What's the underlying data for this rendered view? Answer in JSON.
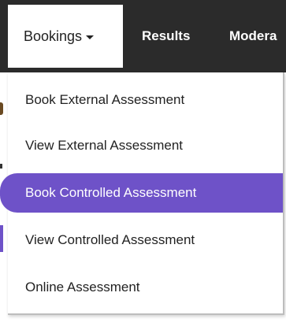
{
  "navbar": {
    "bookings_label": "Bookings",
    "results_label": "Results",
    "moderation_label": "Modera"
  },
  "dropdown": {
    "items": [
      {
        "label": "Book External Assessment",
        "active": false
      },
      {
        "label": "View External Assessment",
        "active": false
      },
      {
        "label": "Book Controlled Assessment",
        "active": true
      },
      {
        "label": "View Controlled Assessment",
        "active": false
      },
      {
        "label": "Online Assessment",
        "active": false
      }
    ]
  },
  "colors": {
    "navbar_bg": "#2b2b2b",
    "active_item_bg": "#6e52c8",
    "active_item_text": "#ffffff",
    "text": "#222222"
  },
  "icons": {
    "bookings_caret": "caret-down-icon"
  }
}
